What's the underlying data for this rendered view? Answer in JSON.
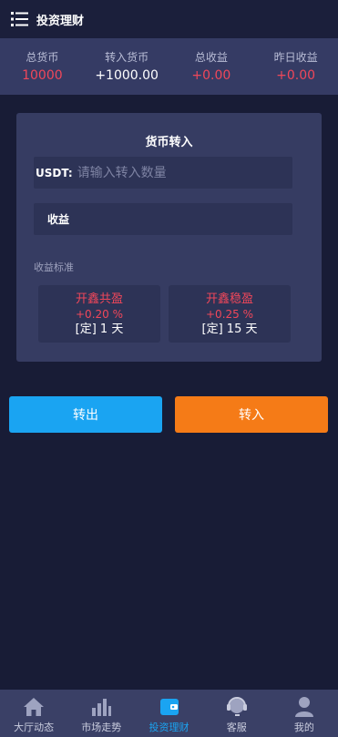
{
  "header": {
    "title": "投资理财"
  },
  "stats": [
    {
      "label": "总货币",
      "value": "10000",
      "tone": "red"
    },
    {
      "label": "转入货币",
      "value": "+1000.00",
      "tone": "white"
    },
    {
      "label": "总收益",
      "value": "+0.00",
      "tone": "red"
    },
    {
      "label": "昨日收益",
      "value": "+0.00",
      "tone": "red"
    }
  ],
  "transfer": {
    "title": "货币转入",
    "usdt_label": "USDT:",
    "usdt_placeholder": "请输入转入数量",
    "income_label": "收益"
  },
  "standards": {
    "label": "收益标准",
    "plans": [
      {
        "name": "开鑫共盈",
        "rate": "+0.20 %",
        "term": "[定] 1 天"
      },
      {
        "name": "开鑫稳盈",
        "rate": "+0.25 %",
        "term": "[定] 15 天"
      }
    ]
  },
  "actions": {
    "out_label": "转出",
    "in_label": "转入"
  },
  "tabbar": {
    "items": [
      {
        "label": "大厅动态",
        "icon": "home-icon"
      },
      {
        "label": "市场走势",
        "icon": "bar-chart-icon"
      },
      {
        "label": "投资理财",
        "icon": "wallet-icon",
        "active": true
      },
      {
        "label": "客服",
        "icon": "headset-icon"
      },
      {
        "label": "我的",
        "icon": "user-icon"
      }
    ]
  },
  "colors": {
    "accent_blue": "#1aa4f2",
    "accent_orange": "#f57b17",
    "value_red": "#f0475a",
    "background": "#181c36"
  }
}
